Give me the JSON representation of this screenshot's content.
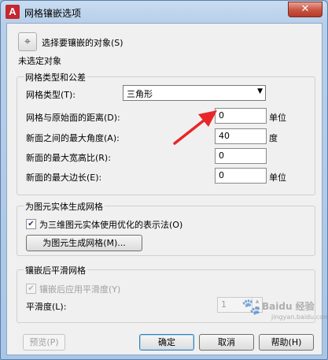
{
  "window": {
    "title": "网格镶嵌选项",
    "close_label": "✕"
  },
  "select_objects": {
    "button_label": "选择要镶嵌的对象(S)",
    "status": "未选定对象"
  },
  "mesh_type_group": {
    "title": "网格类型和公差",
    "mesh_type_label": "网格类型(T):",
    "mesh_type_value": "三角形",
    "distance_label": "网格与原始面的距离(D):",
    "distance_value": "0",
    "distance_unit": "单位",
    "angle_label": "新面之间的最大角度(A):",
    "angle_value": "40",
    "angle_unit": "度",
    "aspect_label": "新面的最大宽高比(R):",
    "aspect_value": "0",
    "edge_label": "新面的最大边长(E):",
    "edge_value": "0",
    "edge_unit": "单位"
  },
  "primitive_group": {
    "title": "为图元实体生成网格",
    "optimize_checkbox_label": "为三维图元实体使用优化的表示法(O)",
    "optimize_checked": true,
    "generate_button_label": "为图元生成网格(M)..."
  },
  "smooth_group": {
    "title": "镶嵌后平滑网格",
    "apply_checkbox_label": "镶嵌后应用平滑度(Y)",
    "apply_checked": true,
    "smoothness_label": "平滑度(L):",
    "smoothness_value": "1"
  },
  "buttons": {
    "preview": "预览(P)",
    "ok": "确定",
    "cancel": "取消",
    "help": "帮助(H)"
  },
  "watermark": {
    "text": "Baidu 经验",
    "sub": "jingyan.baidu.com"
  },
  "colors": {
    "annotation_arrow": "#e8262a",
    "title_bar": "#b7cfea",
    "app_icon": "#c6262e"
  },
  "icons": {
    "app": "autocad-icon",
    "pick": "crosshair-pick-icon",
    "close": "close-icon"
  }
}
